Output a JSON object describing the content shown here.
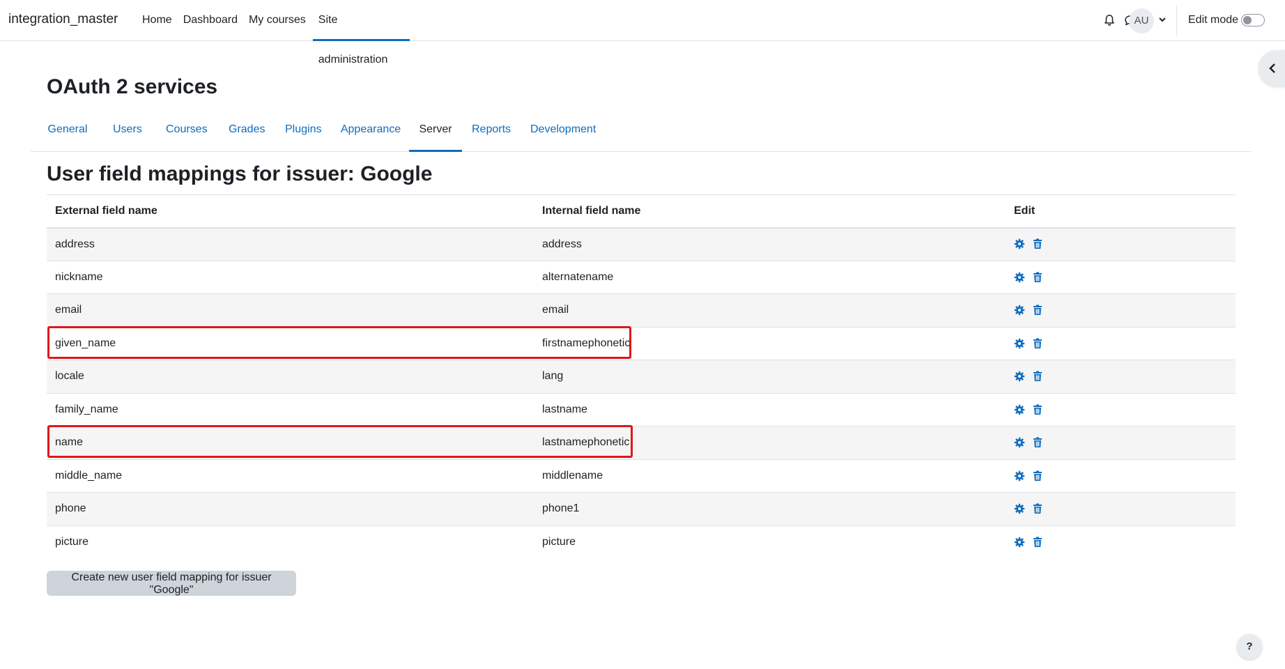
{
  "navbar": {
    "brand": "integration_master",
    "items": [
      {
        "label": "Home"
      },
      {
        "label": "Dashboard"
      },
      {
        "label": "My courses"
      },
      {
        "label": "Site administration",
        "active": true
      }
    ],
    "avatar_initials": "AU",
    "edit_mode_label": "Edit mode",
    "edit_mode_on": false
  },
  "page": {
    "title": "OAuth 2 services",
    "tabs": [
      {
        "label": "General"
      },
      {
        "label": "Users"
      },
      {
        "label": "Courses"
      },
      {
        "label": "Grades"
      },
      {
        "label": "Plugins"
      },
      {
        "label": "Appearance"
      },
      {
        "label": "Server",
        "active": true
      },
      {
        "label": "Reports"
      },
      {
        "label": "Development"
      }
    ],
    "section_title": "User field mappings for issuer: Google"
  },
  "table": {
    "headers": {
      "external": "External field name",
      "internal": "Internal field name",
      "edit": "Edit"
    },
    "rows": [
      {
        "external": "address",
        "internal": "address"
      },
      {
        "external": "nickname",
        "internal": "alternatename"
      },
      {
        "external": "email",
        "internal": "email"
      },
      {
        "external": "given_name",
        "internal": "firstnamephonetic",
        "highlighted": true
      },
      {
        "external": "locale",
        "internal": "lang"
      },
      {
        "external": "family_name",
        "internal": "lastname"
      },
      {
        "external": "name",
        "internal": "lastnamephonetic",
        "highlighted": true
      },
      {
        "external": "middle_name",
        "internal": "middlename"
      },
      {
        "external": "phone",
        "internal": "phone1"
      },
      {
        "external": "picture",
        "internal": "picture"
      }
    ],
    "row_actions": [
      "gear-icon",
      "trash-icon"
    ]
  },
  "create_button": "Create new user field mapping for issuer \"Google\"",
  "help_button": "?",
  "colors": {
    "link": "#0f6cbf",
    "highlight": "#e0161b",
    "button": "#ced4da"
  }
}
